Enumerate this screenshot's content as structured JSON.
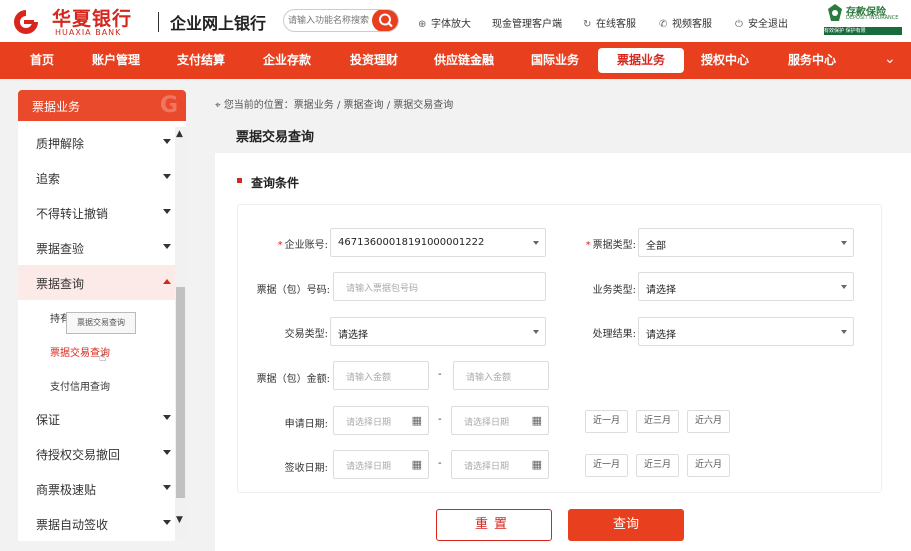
{
  "header": {
    "brand_cn": "华夏银行",
    "brand_en": "HUAXIA BANK",
    "subtitle": "企业网上银行",
    "search_placeholder": "请输入功能名称搜索",
    "links": [
      {
        "icon": "search-zoom-icon",
        "label": "字体放大"
      },
      {
        "icon": "",
        "label": "现金管理客户端"
      },
      {
        "icon": "refresh-icon",
        "label": "在线客服"
      },
      {
        "icon": "phone-icon",
        "label": "视频客服"
      },
      {
        "icon": "power-icon",
        "label": "安全退出"
      }
    ],
    "badge_title": "存款保险",
    "badge_sub": "DEPOSIT INSURANCE",
    "badge_bar": "有效保护 保护有限"
  },
  "nav": {
    "items": [
      "首页",
      "账户管理",
      "支付结算",
      "企业存款",
      "投资理财",
      "供应链金融",
      "国际业务",
      "票据业务",
      "授权中心",
      "服务中心"
    ],
    "active_index": 7
  },
  "sidebar": {
    "title": "票据业务",
    "items": [
      {
        "label": "质押解除"
      },
      {
        "label": "追索"
      },
      {
        "label": "不得转让撤销"
      },
      {
        "label": "票据查验"
      },
      {
        "label": "票据查询",
        "open": true
      },
      {
        "label": "保证"
      },
      {
        "label": "待授权交易撤回"
      },
      {
        "label": "商票极速贴"
      },
      {
        "label": "票据自动签收"
      }
    ],
    "subitems": [
      "持有票据查询",
      "票据交易查询",
      "支付信用查询"
    ],
    "tooltip": "票据交易查询"
  },
  "breadcrumb": "您当前的位置：票据业务 / 票据查询 / 票据交易查询",
  "page_title": "票据交易查询",
  "section_title": "查询条件",
  "form": {
    "account_label": "企业账号:",
    "account_value": "46713600018191000001222",
    "bill_type_label": "票据类型:",
    "bill_type_value": "全部",
    "bill_no_label": "票据（包）号码:",
    "bill_no_placeholder": "请输入票据包号码",
    "biz_type_label": "业务类型:",
    "biz_type_value": "请选择",
    "tx_type_label": "交易类型:",
    "tx_type_value": "请选择",
    "result_label": "处理结果:",
    "result_value": "请选择",
    "amount_label": "票据（包）金额:",
    "amount_placeholder": "请输入金额",
    "apply_date_label": "申请日期:",
    "sign_date_label": "签收日期:",
    "date_placeholder": "请选择日期",
    "quick": [
      "近一月",
      "近三月",
      "近六月"
    ],
    "dash": "-"
  },
  "buttons": {
    "reset": "重置",
    "query": "查询"
  },
  "colors": {
    "brand_red": "#d8261c",
    "nav_orange": "#e8401e"
  }
}
